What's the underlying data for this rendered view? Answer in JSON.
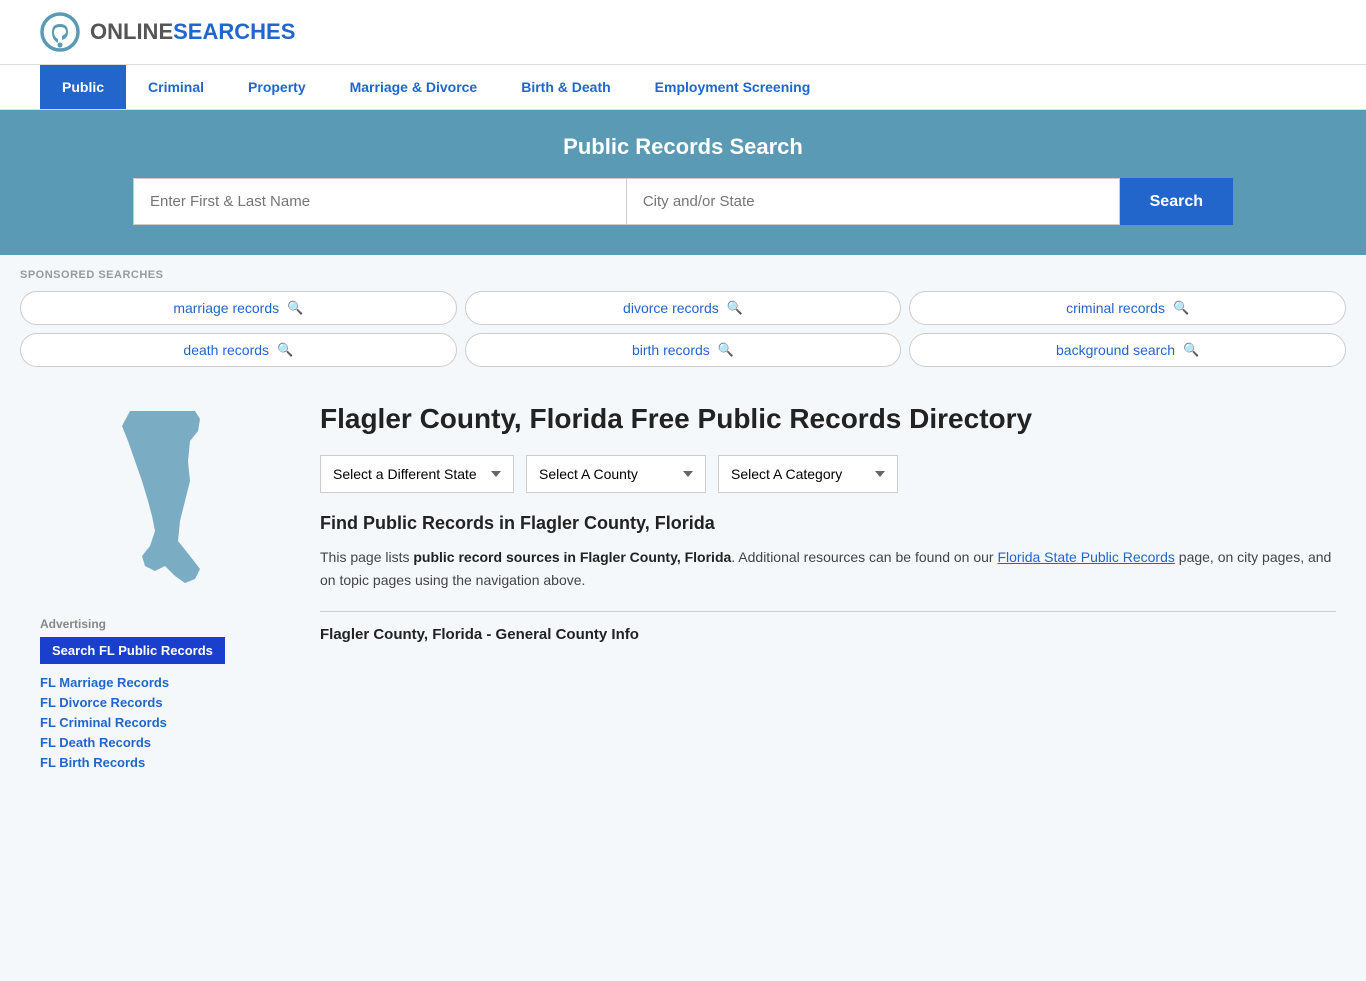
{
  "header": {
    "logo_online": "ONLINE",
    "logo_searches": "SEARCHES",
    "logo_icon_label": "OnlineSearches logo"
  },
  "nav": {
    "items": [
      {
        "label": "Public",
        "active": true
      },
      {
        "label": "Criminal",
        "active": false
      },
      {
        "label": "Property",
        "active": false
      },
      {
        "label": "Marriage & Divorce",
        "active": false
      },
      {
        "label": "Birth & Death",
        "active": false
      },
      {
        "label": "Employment Screening",
        "active": false
      }
    ]
  },
  "hero": {
    "title": "Public Records Search",
    "name_placeholder": "Enter First & Last Name",
    "location_placeholder": "City and/or State",
    "search_button": "Search"
  },
  "sponsored": {
    "label": "SPONSORED SEARCHES",
    "pills": [
      {
        "text": "marriage records"
      },
      {
        "text": "divorce records"
      },
      {
        "text": "criminal records"
      },
      {
        "text": "death records"
      },
      {
        "text": "birth records"
      },
      {
        "text": "background search"
      }
    ]
  },
  "sidebar": {
    "advertising_label": "Advertising",
    "ad_button": "Search FL Public Records",
    "links": [
      {
        "label": "FL Marriage Records"
      },
      {
        "label": "FL Divorce Records"
      },
      {
        "label": "FL Criminal Records"
      },
      {
        "label": "FL Death Records"
      },
      {
        "label": "FL Birth Records"
      }
    ]
  },
  "content": {
    "page_title": "Flagler County, Florida Free Public Records Directory",
    "dropdowns": {
      "state": {
        "label": "Select a Different State"
      },
      "county": {
        "label": "Select A County"
      },
      "category": {
        "label": "Select A Category"
      }
    },
    "find_heading": "Find Public Records in Flagler County, Florida",
    "body_paragraph": "This page lists public record sources in Flagler County, Florida. Additional resources can be found on our Florida State Public Records page, on city pages, and on topic pages using the navigation above.",
    "body_bold_1": "public record sources in Flagler County, Florida",
    "body_link_text": "Florida State Public Records",
    "section_subtitle": "Flagler County, Florida - General County Info"
  }
}
